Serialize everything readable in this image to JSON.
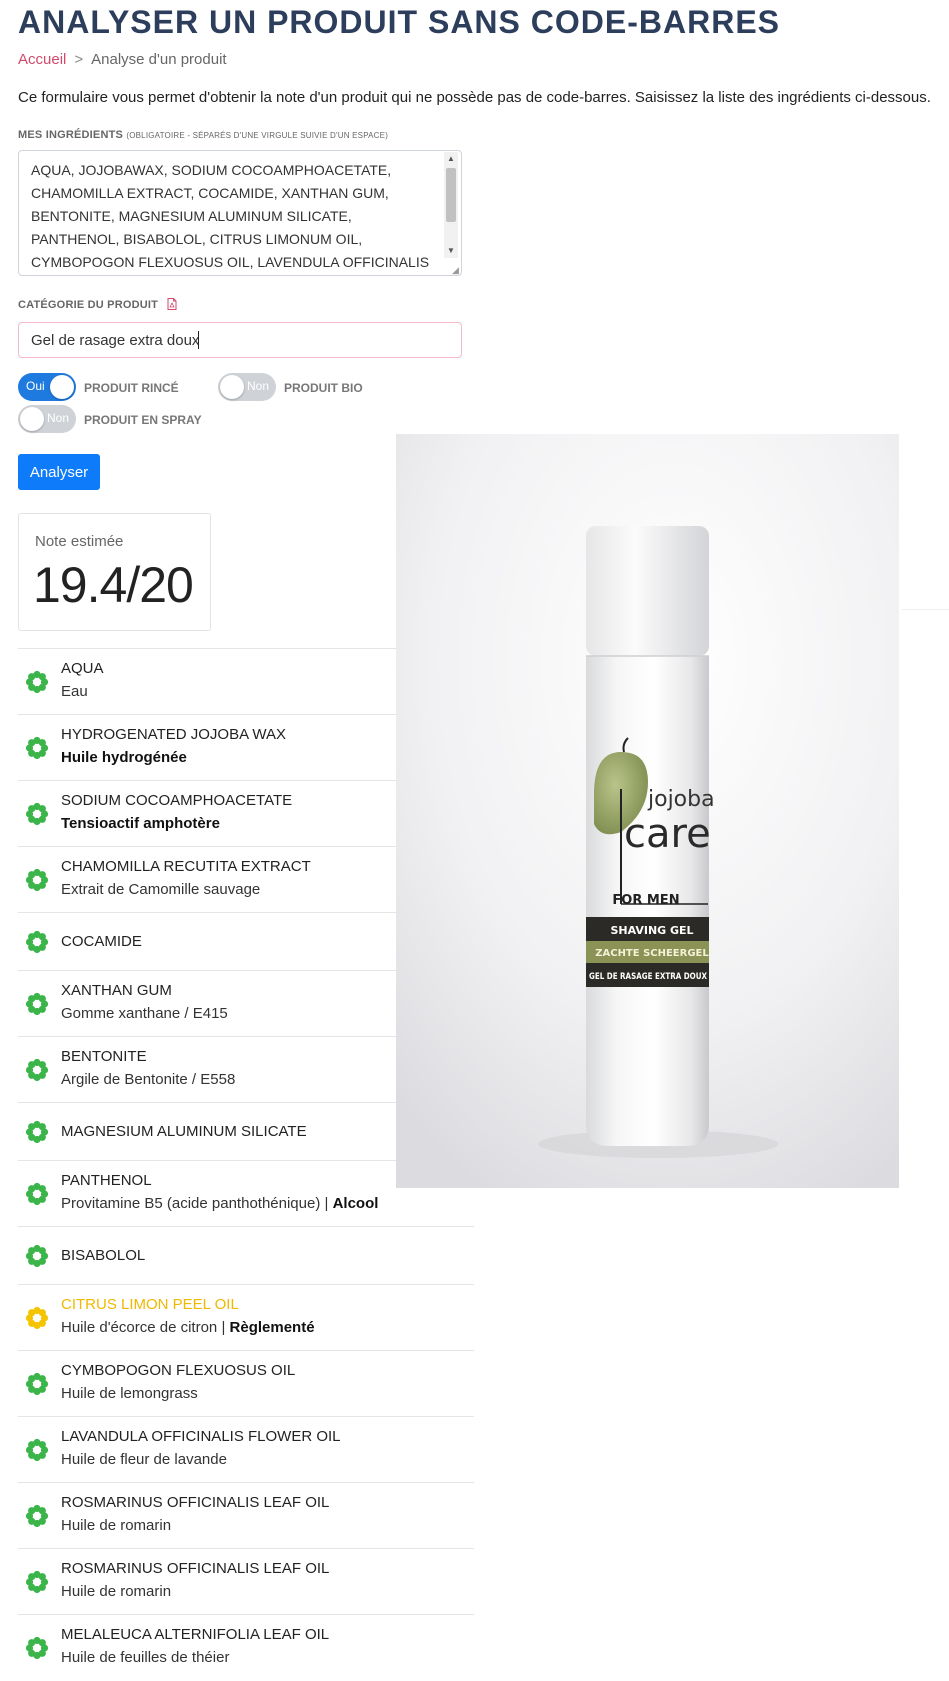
{
  "page": {
    "title": "ANALYSER UN PRODUIT SANS CODE-BARRES",
    "breadcrumb": {
      "home": "Accueil",
      "separator": ">",
      "current": "Analyse d'un produit"
    },
    "intro": "Ce formulaire vous permet d'obtenir la note d'un produit qui ne possède pas de code-barres. Saisissez la liste des ingrédients ci-dessous."
  },
  "form": {
    "ingredients_label": "MES INGRÉDIENTS",
    "ingredients_hint": "(OBLIGATOIRE - SÉPARÉS D'UNE VIRGULE SUIVIE D'UN ESPACE)",
    "ingredients_value": "AQUA, JOJOBAWAX, SODIUM COCOAMPHOACETATE, CHAMOMILLA EXTRACT, COCAMIDE, XANTHAN GUM, BENTONITE, MAGNESIUM ALUMINUM SILICATE, PANTHENOL, BISABOLOL, CITRUS LIMONUM OIL, CYMBOPOGON FLEXUOSUS OIL, LAVENDULA OFFICINALIS",
    "category_label": "CATÉGORIE DU PRODUIT",
    "category_value": "Gel de rasage extra doux",
    "toggles": [
      {
        "state": "Oui",
        "on": true,
        "label": "PRODUIT RINCÉ"
      },
      {
        "state": "Non",
        "on": false,
        "label": "PRODUIT BIO"
      },
      {
        "state": "Non",
        "on": false,
        "label": "PRODUIT EN SPRAY"
      }
    ],
    "submit_label": "Analyser"
  },
  "result": {
    "score_label": "Note estimée",
    "score_value": "19.4/20"
  },
  "ingredients": [
    {
      "name": "AQUA",
      "desc": "Eau",
      "extra": "",
      "bold": false,
      "status": "green"
    },
    {
      "name": "HYDROGENATED JOJOBA WAX",
      "desc": "Huile hydrogénée",
      "extra": "",
      "bold": true,
      "status": "green"
    },
    {
      "name": "SODIUM COCOAMPHOACETATE",
      "desc": "Tensioactif amphotère",
      "extra": "",
      "bold": true,
      "status": "green"
    },
    {
      "name": "CHAMOMILLA RECUTITA EXTRACT",
      "desc": "Extrait de Camomille sauvage",
      "extra": "",
      "bold": false,
      "status": "green"
    },
    {
      "name": "COCAMIDE",
      "desc": "",
      "extra": "",
      "bold": false,
      "status": "green"
    },
    {
      "name": "XANTHAN GUM",
      "desc": "Gomme xanthane / E415",
      "extra": "",
      "bold": false,
      "status": "green"
    },
    {
      "name": "BENTONITE",
      "desc": "Argile de Bentonite / E558",
      "extra": "",
      "bold": false,
      "status": "green"
    },
    {
      "name": "MAGNESIUM ALUMINUM SILICATE",
      "desc": "",
      "extra": "",
      "bold": false,
      "status": "green"
    },
    {
      "name": "PANTHENOL",
      "desc": "Provitamine B5 (acide panthothénique)",
      "extra": "Alcool",
      "bold": false,
      "status": "green"
    },
    {
      "name": "BISABOLOL",
      "desc": "",
      "extra": "",
      "bold": false,
      "status": "green"
    },
    {
      "name": "CITRUS LIMON PEEL OIL",
      "desc": "Huile d'écorce de citron",
      "extra": "Règlementé",
      "bold": false,
      "status": "yellow"
    },
    {
      "name": "CYMBOPOGON FLEXUOSUS OIL",
      "desc": "Huile de lemongrass",
      "extra": "",
      "bold": false,
      "status": "green"
    },
    {
      "name": "LAVANDULA OFFICINALIS FLOWER OIL",
      "desc": "Huile de fleur de lavande",
      "extra": "",
      "bold": false,
      "status": "green"
    },
    {
      "name": "ROSMARINUS OFFICINALIS LEAF OIL",
      "desc": "Huile de romarin",
      "extra": "",
      "bold": false,
      "status": "green"
    },
    {
      "name": "ROSMARINUS OFFICINALIS LEAF OIL",
      "desc": "Huile de romarin",
      "extra": "",
      "bold": false,
      "status": "green"
    },
    {
      "name": "MELALEUCA ALTERNIFOLIA LEAF OIL",
      "desc": "Huile de feuilles de théier",
      "extra": "",
      "bold": false,
      "status": "green"
    }
  ],
  "photo": {
    "brand_top": "jojoba",
    "brand_main": "care",
    "line": "FOR MEN",
    "band1": "SHAVING GEL",
    "band2": "ZACHTE SCHEERGEL",
    "band3": "GEL DE RASAGE EXTRA DOUX"
  },
  "colors": {
    "title": "#2c3e5c",
    "link": "#d04a6d",
    "primary": "#0d7bfa",
    "toggle_on": "#1f7ae0",
    "status_green": "#3bb54a",
    "status_yellow": "#f5c400"
  }
}
